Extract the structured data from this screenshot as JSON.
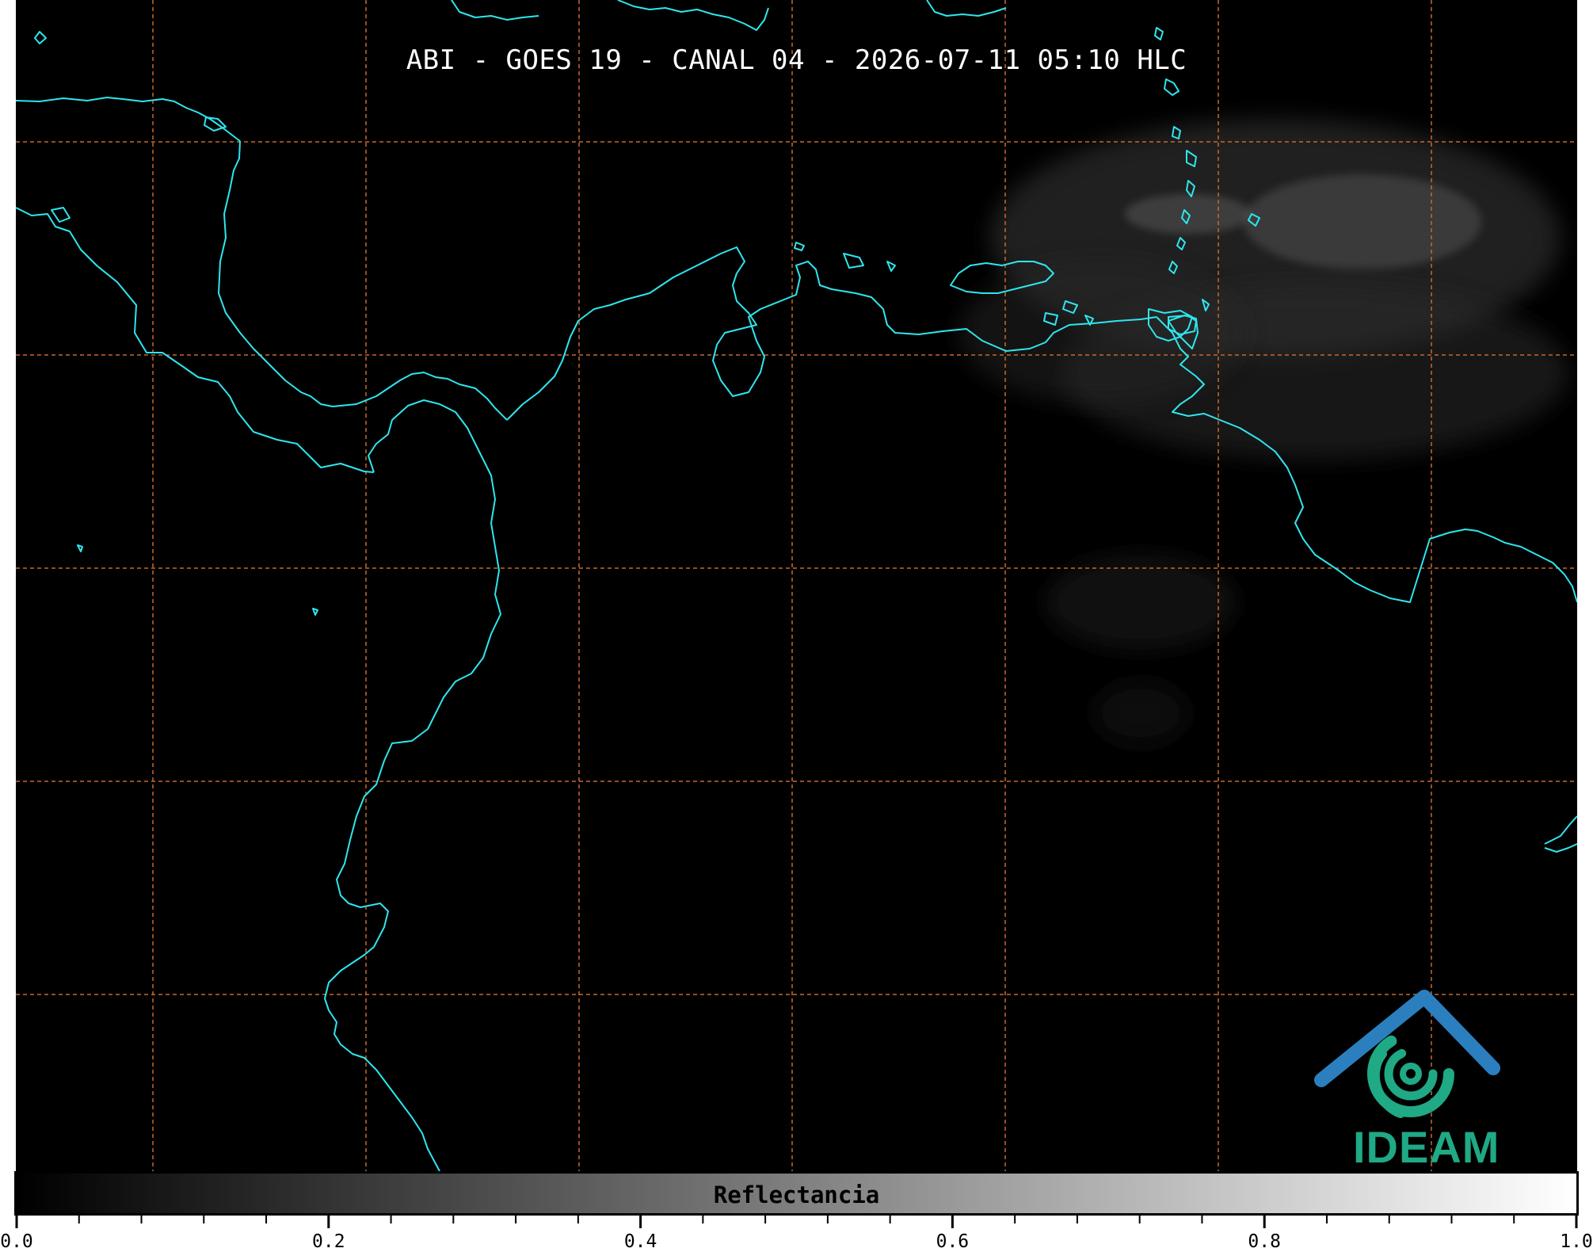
{
  "map": {
    "title": "ABI - GOES 19 - CANAL 04 - 2026-07-11 05:10 HLC",
    "background_color": "#000000",
    "coastline_color": "#2ee6ee",
    "graticule_color": "#c8692a"
  },
  "logo": {
    "text": "IDEAM",
    "roof_color": "#2b7fbf",
    "swirl_color": "#1fa985"
  },
  "colorbar": {
    "label": "Reflectancia",
    "ticks": [
      {
        "label": "0.0",
        "value": 0.0
      },
      {
        "label": "0.2",
        "value": 0.2
      },
      {
        "label": "0.4",
        "value": 0.4
      },
      {
        "label": "0.6",
        "value": 0.6
      },
      {
        "label": "0.8",
        "value": 0.8
      },
      {
        "label": "1.0",
        "value": 1.0
      }
    ],
    "minor_ticks_per_major": 4,
    "range": [
      0.0,
      1.0
    ]
  }
}
